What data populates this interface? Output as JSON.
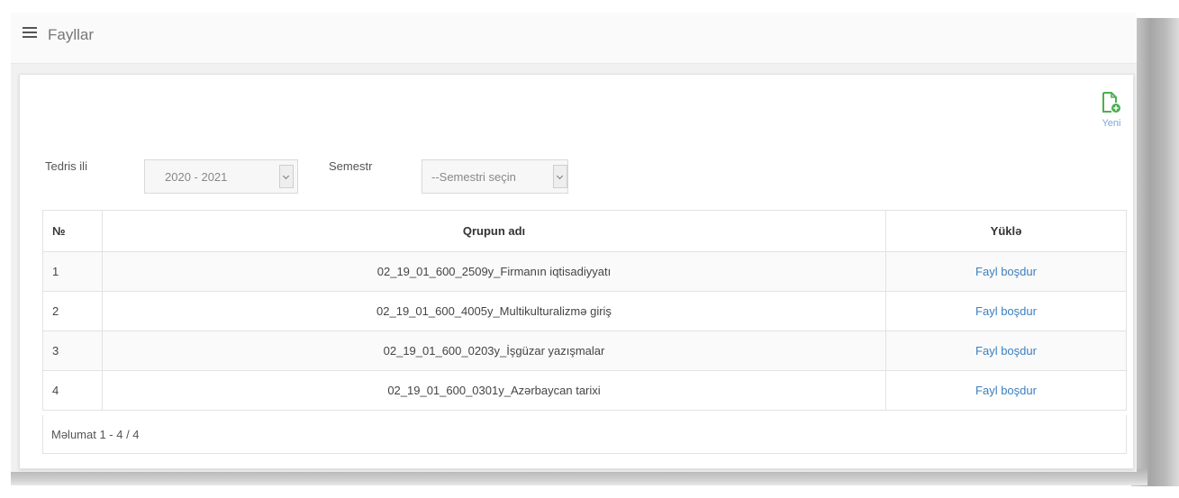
{
  "header": {
    "title": "Fayllar",
    "menu_icon": "hamburger-icon"
  },
  "toolbar": {
    "new_label": "Yeni",
    "new_icon": "file-add-icon",
    "accent": "#4caf50"
  },
  "filters": {
    "year_label": "Tedris ili",
    "year_value": "2020 - 2021",
    "semester_label": "Semestr",
    "semester_value": "--Semestri seçin"
  },
  "table": {
    "columns": [
      "№",
      "Qrupun adı",
      "Yüklə"
    ],
    "rows": [
      {
        "no": "1",
        "name": "02_19_01_600_2509y_Firmanın iqtisadiyyatı",
        "action": "Fayl boşdur"
      },
      {
        "no": "2",
        "name": "02_19_01_600_4005y_Multikulturalizmə giriş",
        "action": "Fayl boşdur"
      },
      {
        "no": "3",
        "name": "02_19_01_600_0203y_İşgüzar yazışmalar",
        "action": "Fayl boşdur"
      },
      {
        "no": "4",
        "name": "02_19_01_600_0301y_Azərbaycan tarixi",
        "action": "Fayl boşdur"
      }
    ]
  },
  "footer": {
    "info": "Məlumat 1 - 4 / 4"
  },
  "colors": {
    "link": "#3c7fbf",
    "page_bg": "#f1f1f1"
  }
}
